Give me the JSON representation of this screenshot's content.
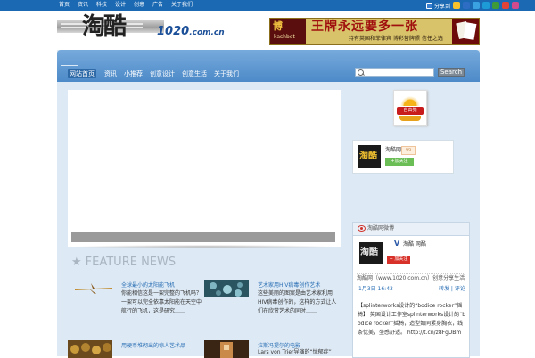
{
  "top_links": [
    "首页",
    "资讯",
    "科技",
    "设计",
    "创意",
    "广告",
    "关于我们"
  ],
  "share": {
    "label": "分享到"
  },
  "logo": {
    "cn": "淘酷",
    "domain": "1020",
    "suffix": ".com.cn"
  },
  "banner": {
    "brand_top": "博",
    "brand_bottom": "kashbet",
    "headline": "王牌永远要多一张",
    "subline": "持有英国和菲律宾 博彩营牌照 信任之选"
  },
  "nav": {
    "items": [
      "网站首页",
      "资讯",
      "小推荐",
      "创意设计",
      "创意生活",
      "关于我们"
    ],
    "active_index": 0
  },
  "search": {
    "placeholder": "",
    "button": "Search"
  },
  "feature": {
    "title": "FEATURE NEWS"
  },
  "news": [
    {
      "title": "全球最小的太阳能飞机",
      "desc": "你能相信这是一架完整的飞机吗？一架可以完全依靠太阳能在天空中航行的飞机，这是研究……"
    },
    {
      "title": "艺术家用HIV病毒创作艺术",
      "desc": "这些美丽的图案是由艺术家利用HIV病毒创作的，这样的方式让人们在欣赏艺术的同时……"
    },
    {
      "title": "用硬币堆砌出的惊人艺术品",
      "desc": ""
    },
    {
      "title": "拉斯冯提尔的电影",
      "desc": "Lars von Trier导演的“忧郁症”"
    }
  ],
  "badge": {
    "label": "自由党"
  },
  "profile": {
    "name": "淘酷网",
    "count": "99",
    "follow_label": "+加关注"
  },
  "weibo": {
    "header": "淘酷网微博",
    "name": "淘酷 网酷",
    "add_label": "+ 加关注",
    "line1": "淘酷网（www.1020.com.cn）创意分享生活",
    "time": "1月3日 16:43",
    "actions": "转发 | 评论",
    "post": "【splinterworks设计的“bodice rocker”摇椅】 英国设计工作室splinterworks设计的“bodice rocker”摇椅，造型如同紧身胸衣，线条优美，坐感舒适。 http://t.cn/z8FgUBm"
  },
  "colors": {
    "topbar": "#1b69b3",
    "nav": "#5b95cf",
    "content_bg": "#dde9f4",
    "link": "#2a6fb5",
    "follow_green": "#6bbd55",
    "add_red": "#d8312a"
  },
  "icons": [
    "share-icon",
    "search-icon",
    "star-icon",
    "weibo-eye-icon",
    "verified-v-icon"
  ]
}
